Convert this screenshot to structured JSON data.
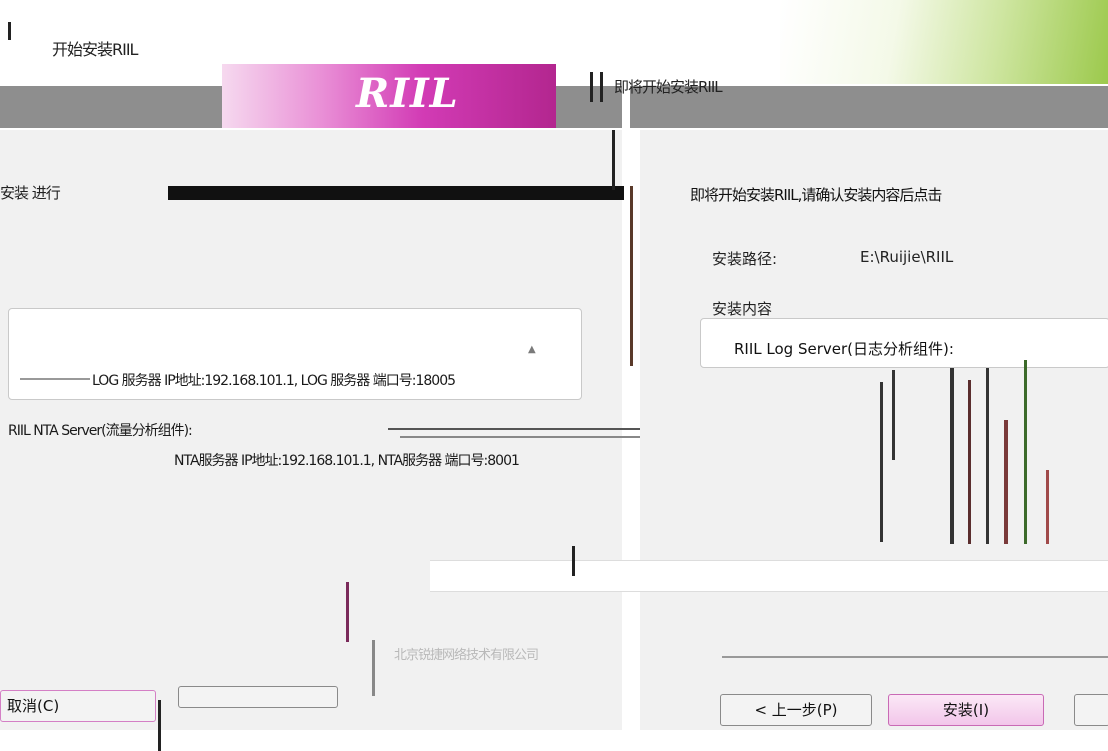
{
  "window": {
    "title_left": "开始安装RIIL",
    "title_right": "即将开始安装RIIL"
  },
  "branding": {
    "logo_text": "RIIL",
    "accent_pink": "#d23bb5",
    "accent_green": "#9cc94c"
  },
  "left_panel": {
    "status_text": "安装 进行",
    "progress_percent": 100,
    "info_lines": [
      "LOG 服务器 IP地址:192.168.101.1, LOG 服务器 端口号:18005",
      "RIIL NTA Server(流量分析组件):",
      "NTA服务器 IP地址:192.168.101.1, NTA服务器 端口号:8001"
    ]
  },
  "right_panel": {
    "message": "即将开始安装RIIL,请确认安装内容后点击",
    "install_path_label": "安装路径:",
    "install_path_value": "E:\\Ruijie\\RIIL",
    "install_content_label": "安装内容",
    "install_content_lines": [
      "RIIL Log Server(日志分析组件):"
    ]
  },
  "footer": {
    "company": "北京锐捷网络技术有限公司"
  },
  "buttons": {
    "cancel": "取消(C)",
    "back": "< 上一步(P)",
    "install": "安装(I)"
  }
}
